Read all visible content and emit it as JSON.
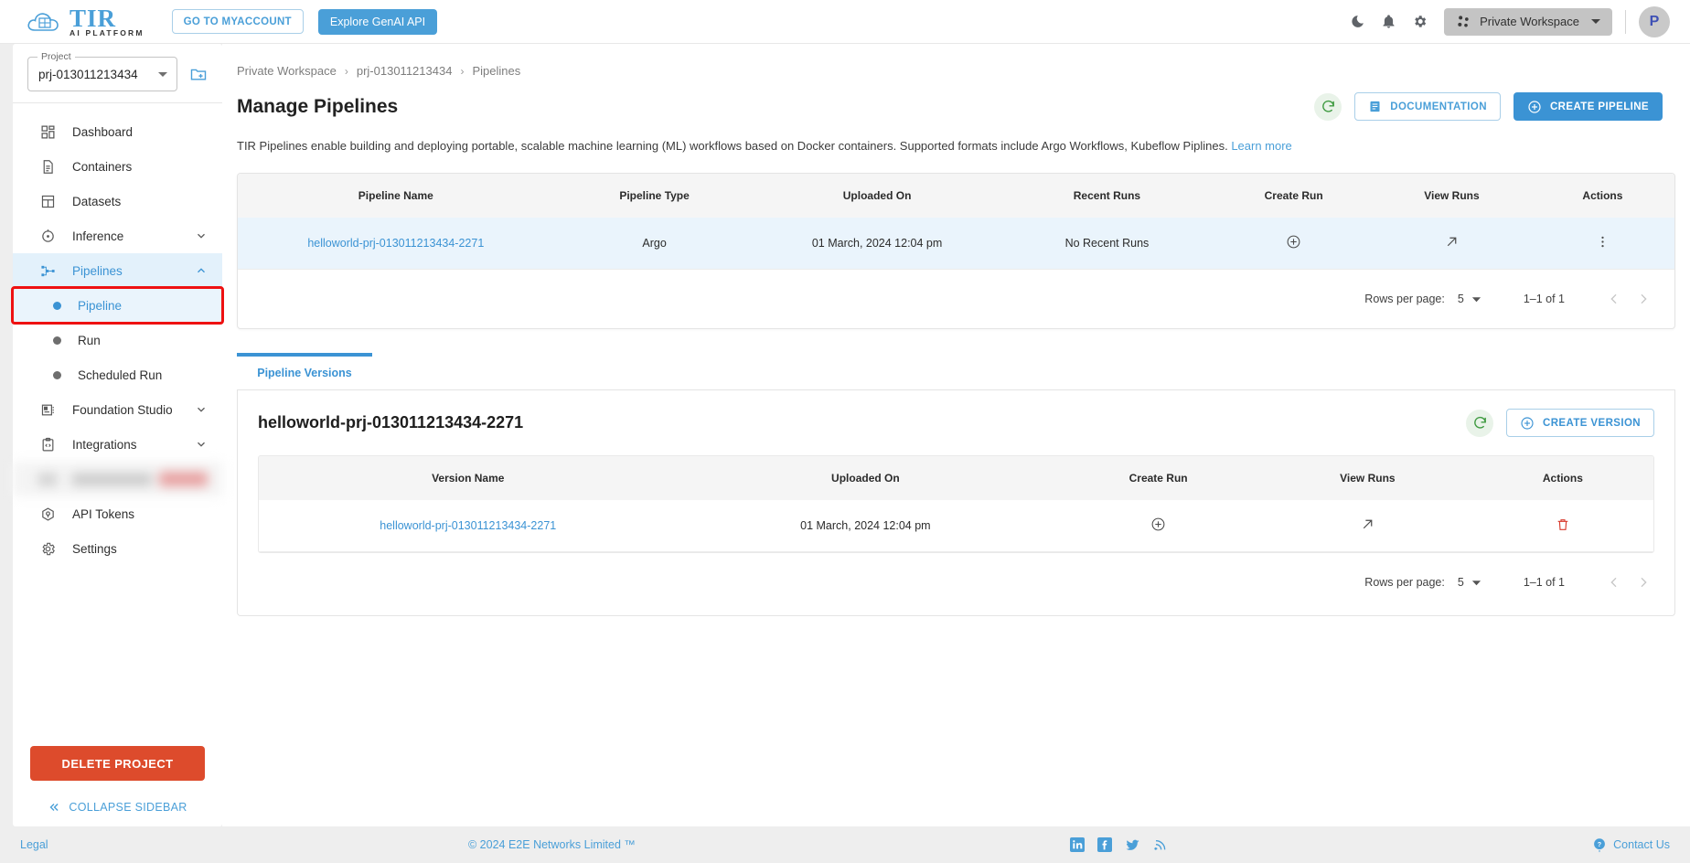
{
  "topbar": {
    "logo_title": "TIR",
    "logo_subtitle": "AI PLATFORM",
    "myaccount_label": "GO TO MYACCOUNT",
    "genai_label": "Explore GenAI API",
    "dark_mode_icon": "moon-icon",
    "notifications_icon": "bell-icon",
    "settings_icon": "gear-icon",
    "workspace_label": "Private Workspace",
    "workspace_icon": "workspace-nodes-icon",
    "avatar_initial": "P"
  },
  "sidebar": {
    "project_label": "Project",
    "project_value": "prj-013011213434",
    "add_project_icon": "folder-add-icon",
    "items": [
      {
        "label": "Dashboard",
        "icon": "dashboard-icon",
        "expandable": false,
        "state": "normal"
      },
      {
        "label": "Containers",
        "icon": "document-icon",
        "expandable": false,
        "state": "normal"
      },
      {
        "label": "Datasets",
        "icon": "grid-icon",
        "expandable": false,
        "state": "normal"
      },
      {
        "label": "Inference",
        "icon": "inference-icon",
        "expandable": true,
        "state": "normal"
      },
      {
        "label": "Pipelines",
        "icon": "pipelines-icon",
        "expandable": true,
        "state": "active"
      }
    ],
    "sub_items": [
      {
        "label": "Pipeline",
        "state": "selected"
      },
      {
        "label": "Run",
        "state": "normal"
      },
      {
        "label": "Scheduled Run",
        "state": "normal"
      }
    ],
    "items_after": [
      {
        "label": "Foundation Studio",
        "icon": "foundation-studio-icon",
        "expandable": true,
        "state": "normal"
      },
      {
        "label": "Integrations",
        "icon": "integrations-icon",
        "expandable": true,
        "state": "normal"
      }
    ],
    "redacted_item": {
      "label": "",
      "state": "blurred"
    },
    "items_bottom": [
      {
        "label": "API Tokens",
        "icon": "token-icon",
        "expandable": false,
        "state": "normal"
      },
      {
        "label": "Settings",
        "icon": "gear-icon",
        "expandable": false,
        "state": "normal"
      }
    ],
    "delete_project_label": "DELETE PROJECT",
    "collapse_label": "COLLAPSE SIDEBAR",
    "collapse_icon": "double-chevron-left-icon"
  },
  "main": {
    "breadcrumb": [
      "Private Workspace",
      "prj-013011213434",
      "Pipelines"
    ],
    "page_title": "Manage Pipelines",
    "refresh_icon": "refresh-icon",
    "documentation_label": "DOCUMENTATION",
    "documentation_icon": "doc-icon",
    "create_pipeline_label": "CREATE PIPELINE",
    "create_pipeline_icon": "plus-circle-icon",
    "description": "TIR Pipelines enable building and deploying portable, scalable machine learning (ML) workflows based on Docker containers. Supported formats include Argo Workflows, Kubeflow Piplines.",
    "learn_more_label": "Learn more"
  },
  "pipelines_table": {
    "headers": [
      "Pipeline Name",
      "Pipeline Type",
      "Uploaded On",
      "Recent Runs",
      "Create Run",
      "View Runs",
      "Actions"
    ],
    "rows": [
      {
        "name": "helloworld-prj-013011213434-2271",
        "type": "Argo",
        "uploaded_on": "01 March, 2024 12:04 pm",
        "recent_runs": "No Recent Runs",
        "create_run_icon": "plus-circle-icon",
        "view_runs_icon": "arrow-up-right-icon",
        "actions_icon": "more-vertical-icon"
      }
    ],
    "pagination": {
      "rows_per_page_label": "Rows per page:",
      "rows_per_page_value": "5",
      "range": "1–1 of 1",
      "prev_icon": "chevron-left-icon",
      "next_icon": "chevron-right-icon"
    }
  },
  "versions_section": {
    "tab_label": "Pipeline Versions",
    "title": "helloworld-prj-013011213434-2271",
    "refresh_icon": "refresh-icon",
    "create_version_label": "CREATE VERSION",
    "create_version_icon": "plus-circle-icon",
    "headers": [
      "Version Name",
      "Uploaded On",
      "Create Run",
      "View Runs",
      "Actions"
    ],
    "rows": [
      {
        "name": "helloworld-prj-013011213434-2271",
        "uploaded_on": "01 March, 2024 12:04 pm",
        "create_run_icon": "plus-circle-icon",
        "view_runs_icon": "arrow-up-right-icon",
        "actions_icon": "trash-icon"
      }
    ],
    "pagination": {
      "rows_per_page_label": "Rows per page:",
      "rows_per_page_value": "5",
      "range": "1–1 of 1",
      "prev_icon": "chevron-left-icon",
      "next_icon": "chevron-right-icon"
    }
  },
  "footer": {
    "legal": "Legal",
    "copyright": "© 2024 E2E Networks Limited ™",
    "social": [
      "linkedin-icon",
      "facebook-icon",
      "twitter-icon",
      "rss-icon"
    ],
    "contact_label": "Contact Us",
    "contact_icon": "question-circle-icon"
  },
  "colors": {
    "accent": "#3b93d4",
    "accent_light": "#4a9fd8",
    "danger": "#dd4b2c",
    "highlight_outline": "#ee1111",
    "row_highlight": "#eaf4fc"
  }
}
